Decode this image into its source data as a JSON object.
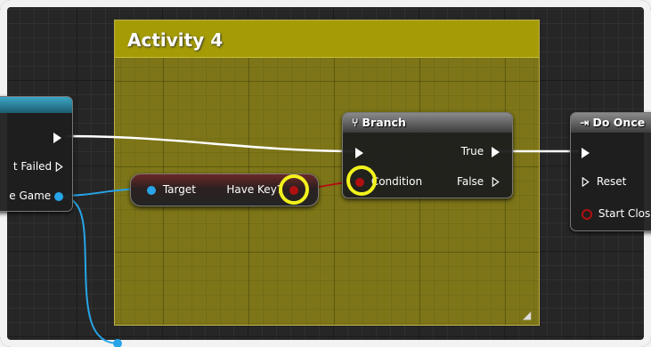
{
  "comment": {
    "title": "Activity 4",
    "color": "#a59c05"
  },
  "left_node": {
    "pins": {
      "failed_label": "t Failed",
      "game_label": "e Game"
    }
  },
  "get_node": {
    "target_label": "Target",
    "output_label": "Have Key?"
  },
  "branch_node": {
    "title": "Branch",
    "icon": "branch-icon",
    "condition_label": "Condition",
    "true_label": "True",
    "false_label": "False"
  },
  "do_once_node": {
    "title": "Do Once",
    "icon": "do-once-icon",
    "reset_label": "Reset",
    "start_closed_label": "Start Clos"
  },
  "colors": {
    "exec_wire": "#ffffff",
    "object_pin": "#27a5e8",
    "bool_pin": "#b11010",
    "highlight_ring": "#f2f21c"
  }
}
